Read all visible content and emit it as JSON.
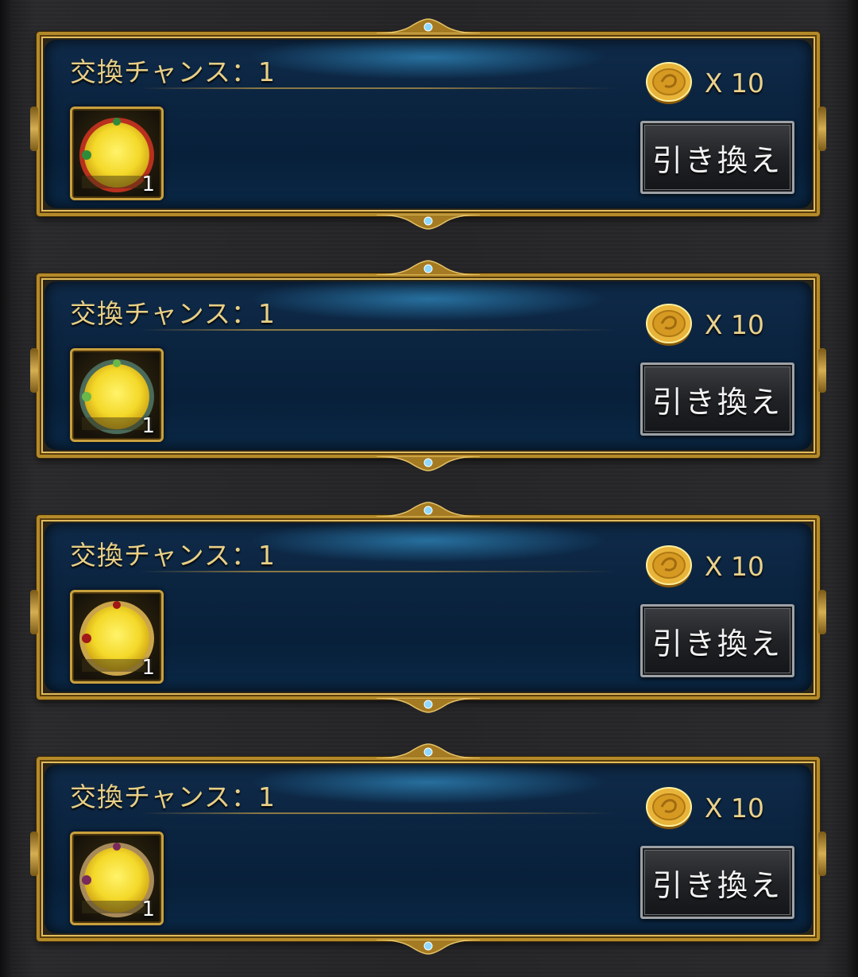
{
  "exchange_list": {
    "items": [
      {
        "chance_label": "交換チャンス：1",
        "cost_label": "X 10",
        "count": "1",
        "redeem_label": "引き換え",
        "frame_color": "#b8301e",
        "accent_color": "#2f8a3a"
      },
      {
        "chance_label": "交換チャンス：1",
        "cost_label": "X 10",
        "count": "1",
        "redeem_label": "引き換え",
        "frame_color": "#4a6a5a",
        "accent_color": "#69b84a"
      },
      {
        "chance_label": "交換チャンス：1",
        "cost_label": "X 10",
        "count": "1",
        "redeem_label": "引き換え",
        "frame_color": "#c9a44a",
        "accent_color": "#a01818"
      },
      {
        "chance_label": "交換チャンス：1",
        "cost_label": "X 10",
        "count": "1",
        "redeem_label": "引き換え",
        "frame_color": "#a88a5a",
        "accent_color": "#7a2a5a"
      }
    ]
  },
  "icons": {
    "currency": "gold-coin-icon",
    "item": "ring-frame-icon"
  },
  "colors": {
    "title_text": "#e8cf86",
    "frame_gold": "#b48a2a",
    "panel_blue": "#0b2440",
    "button_text": "#f2f2f2"
  }
}
